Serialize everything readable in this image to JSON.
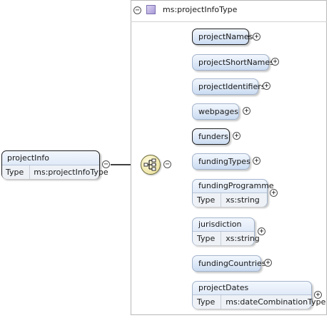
{
  "root": {
    "name": "projectInfo",
    "type_key": "Type",
    "type_value": "ms:projectInfoType"
  },
  "complex_type": {
    "name": "ms:projectInfoType"
  },
  "compositor": {
    "icon": "sequence-icon"
  },
  "toggles": {
    "collapse": "−",
    "expand": "+"
  },
  "children": [
    {
      "name": "projectNames",
      "required": true
    },
    {
      "name": "projectShortNames",
      "required": false
    },
    {
      "name": "projectIdentifiers",
      "required": false
    },
    {
      "name": "webpages",
      "required": false
    },
    {
      "name": "funders",
      "required": true
    },
    {
      "name": "fundingTypes",
      "required": false
    },
    {
      "name": "fundingProgramme",
      "required": false,
      "type_key": "Type",
      "type_value": "xs:string"
    },
    {
      "name": "jurisdiction",
      "required": false,
      "type_key": "Type",
      "type_value": "xs:string"
    },
    {
      "name": "fundingCountries",
      "required": false
    },
    {
      "name": "projectDates",
      "required": false,
      "type_key": "Type",
      "type_value": "ms:dateCombinationType"
    }
  ],
  "colors": {
    "element_fill_top": "#f3f7fd",
    "element_fill_bottom": "#cbdcf2",
    "compositor_fill": "#efe6a8",
    "type_icon": "#a99ad8"
  }
}
